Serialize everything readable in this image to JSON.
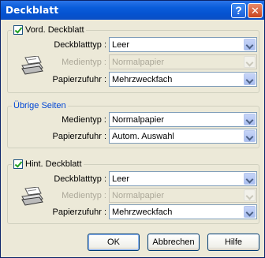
{
  "window": {
    "title": "Deckblatt",
    "help_label": "?",
    "close_label": "✕"
  },
  "front": {
    "label": "Vord. Deckblatt",
    "rows": [
      {
        "label": "Deckblatttyp :",
        "value": "Leer",
        "disabled": false
      },
      {
        "label": "Medientyp :",
        "value": "Normalpapier",
        "disabled": true
      },
      {
        "label": "Papierzufuhr :",
        "value": "Mehrzweckfach",
        "disabled": false
      }
    ]
  },
  "other": {
    "label": "Übrige Seiten",
    "rows": [
      {
        "label": "Medientyp :",
        "value": "Normalpapier",
        "disabled": false
      },
      {
        "label": "Papierzufuhr :",
        "value": "Autom. Auswahl",
        "disabled": false
      }
    ]
  },
  "back": {
    "label": "Hint. Deckblatt",
    "rows": [
      {
        "label": "Deckblatttyp :",
        "value": "Leer",
        "disabled": false
      },
      {
        "label": "Medientyp :",
        "value": "Normalpapier",
        "disabled": true
      },
      {
        "label": "Papierzufuhr :",
        "value": "Mehrzweckfach",
        "disabled": false
      }
    ]
  },
  "buttons": {
    "ok": "OK",
    "cancel": "Abbrechen",
    "help": "Hilfe"
  },
  "icons": {
    "front": "printer-paper-icon",
    "back": "printer-paper-icon"
  }
}
